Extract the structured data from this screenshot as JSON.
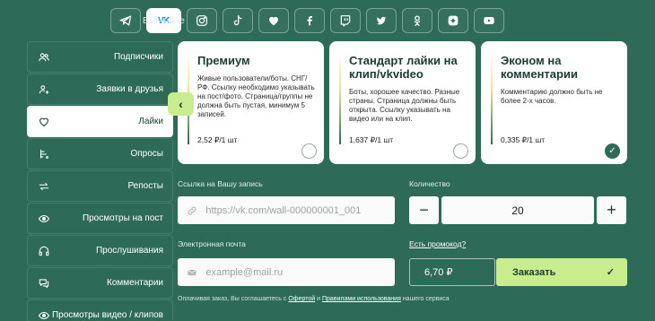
{
  "platforms": [
    {
      "icon": "telegram-icon"
    },
    {
      "icon": "vk-icon",
      "label": "Вконтакте",
      "active": true
    },
    {
      "icon": "instagram-icon"
    },
    {
      "icon": "tiktok-icon"
    },
    {
      "icon": "heart-icon"
    },
    {
      "icon": "facebook-icon"
    },
    {
      "icon": "twitch-icon"
    },
    {
      "icon": "twitter-icon"
    },
    {
      "icon": "odnoklassniki-icon"
    },
    {
      "icon": "dzen-icon"
    },
    {
      "icon": "youtube-icon"
    }
  ],
  "sidebar": {
    "items": [
      {
        "label": "Подписчики",
        "icon": "users-icon"
      },
      {
        "label": "Заявки в друзья",
        "icon": "friend-requests-icon"
      },
      {
        "label": "Лайки",
        "icon": "heart-icon",
        "active": true
      },
      {
        "label": "Опросы",
        "icon": "poll-icon"
      },
      {
        "label": "Репосты",
        "icon": "repost-icon"
      },
      {
        "label": "Просмотры на пост",
        "icon": "eye-icon"
      },
      {
        "label": "Прослушивания",
        "icon": "headphones-icon"
      },
      {
        "label": "Комментарии",
        "icon": "comments-icon"
      },
      {
        "label": "Просмотры видео / клипов",
        "icon": "eye-icon"
      }
    ]
  },
  "cards": [
    {
      "title": "Премиум",
      "desc": "Живые пользователи/боты. СНГ/РФ. Ссылку необходимо указывать на пост/фото. Страница/группы не должна быть пустая, минимум 5 записей.",
      "price": "2,52 ₽/1 шт",
      "selected": false
    },
    {
      "title": "Стандарт лайки на клип/vkvideo",
      "desc": "Боты, хорошее качество. Разные страны. Страница должны быть открыта. Ссылку указывать на видео или на клип.",
      "price": "1,637 ₽/1 шт",
      "selected": false
    },
    {
      "title": "Эконом на комментарии",
      "desc": "Комментарию должно быть не более 2-х часов.",
      "price": "0,335 ₽/1 шт",
      "selected": true
    }
  ],
  "form": {
    "link_label": "Ссылка на Вашу запись",
    "link_placeholder": "https://vk.com/wall-000000001_001",
    "qty_label": "Количество",
    "qty_value": "20",
    "qty_minus": "−",
    "qty_plus": "+",
    "email_label": "Электронная почта",
    "email_placeholder": "example@mail.ru",
    "promo_link": "Есть промокод?",
    "total": "6,70 ₽",
    "order_button": "Заказать",
    "legal_prefix": "Оплачивая заказ, Вы соглашаетесь с",
    "legal_offer": "Офертой",
    "legal_and": "и",
    "legal_rules": "Правилами использования",
    "legal_suffix": "нашего сервиса"
  },
  "colors": {
    "background": "#2d6b58",
    "accent": "#c9ec8e",
    "card_bg": "#ffffff"
  }
}
